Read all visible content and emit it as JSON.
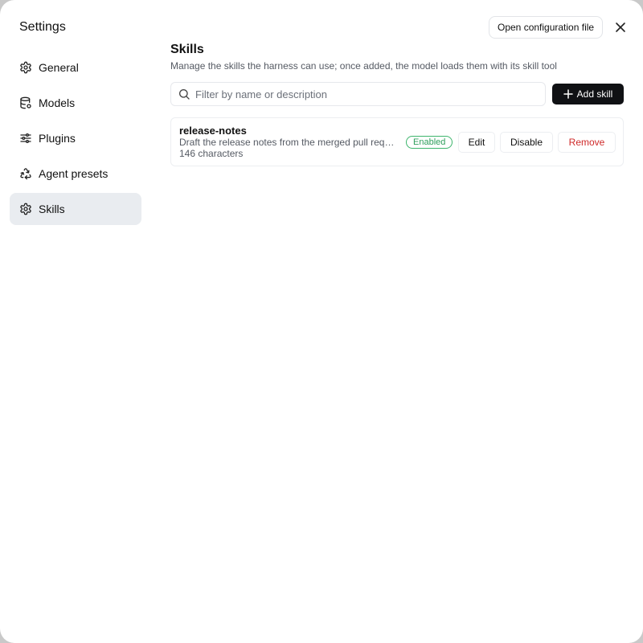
{
  "window": {
    "title": "Settings",
    "open_config_label": "Open configuration file"
  },
  "sidebar": {
    "items": [
      {
        "label": "General",
        "icon": "gear-icon",
        "active": false
      },
      {
        "label": "Models",
        "icon": "database-gear-icon",
        "active": false
      },
      {
        "label": "Plugins",
        "icon": "sliders-icon",
        "active": false
      },
      {
        "label": "Agent presets",
        "icon": "recycle-icon",
        "active": false
      },
      {
        "label": "Skills",
        "icon": "gear-icon",
        "active": true
      }
    ]
  },
  "main": {
    "title": "Skills",
    "subtitle": "Manage the skills the harness can use; once added, the model loads them with its skill tool",
    "search": {
      "placeholder": "Filter by name or description",
      "value": ""
    },
    "add_label": "Add skill",
    "skills": [
      {
        "name": "release-notes",
        "description": "Draft the release notes from the merged pull requests",
        "meta": "146 characters",
        "status": "Enabled",
        "edit_label": "Edit",
        "disable_label": "Disable",
        "remove_label": "Remove"
      }
    ]
  },
  "colors": {
    "accent": "#101114",
    "active_nav_bg": "#e9ecf0",
    "status_enabled": "#2e9e5b",
    "danger": "#cf2a2a"
  }
}
